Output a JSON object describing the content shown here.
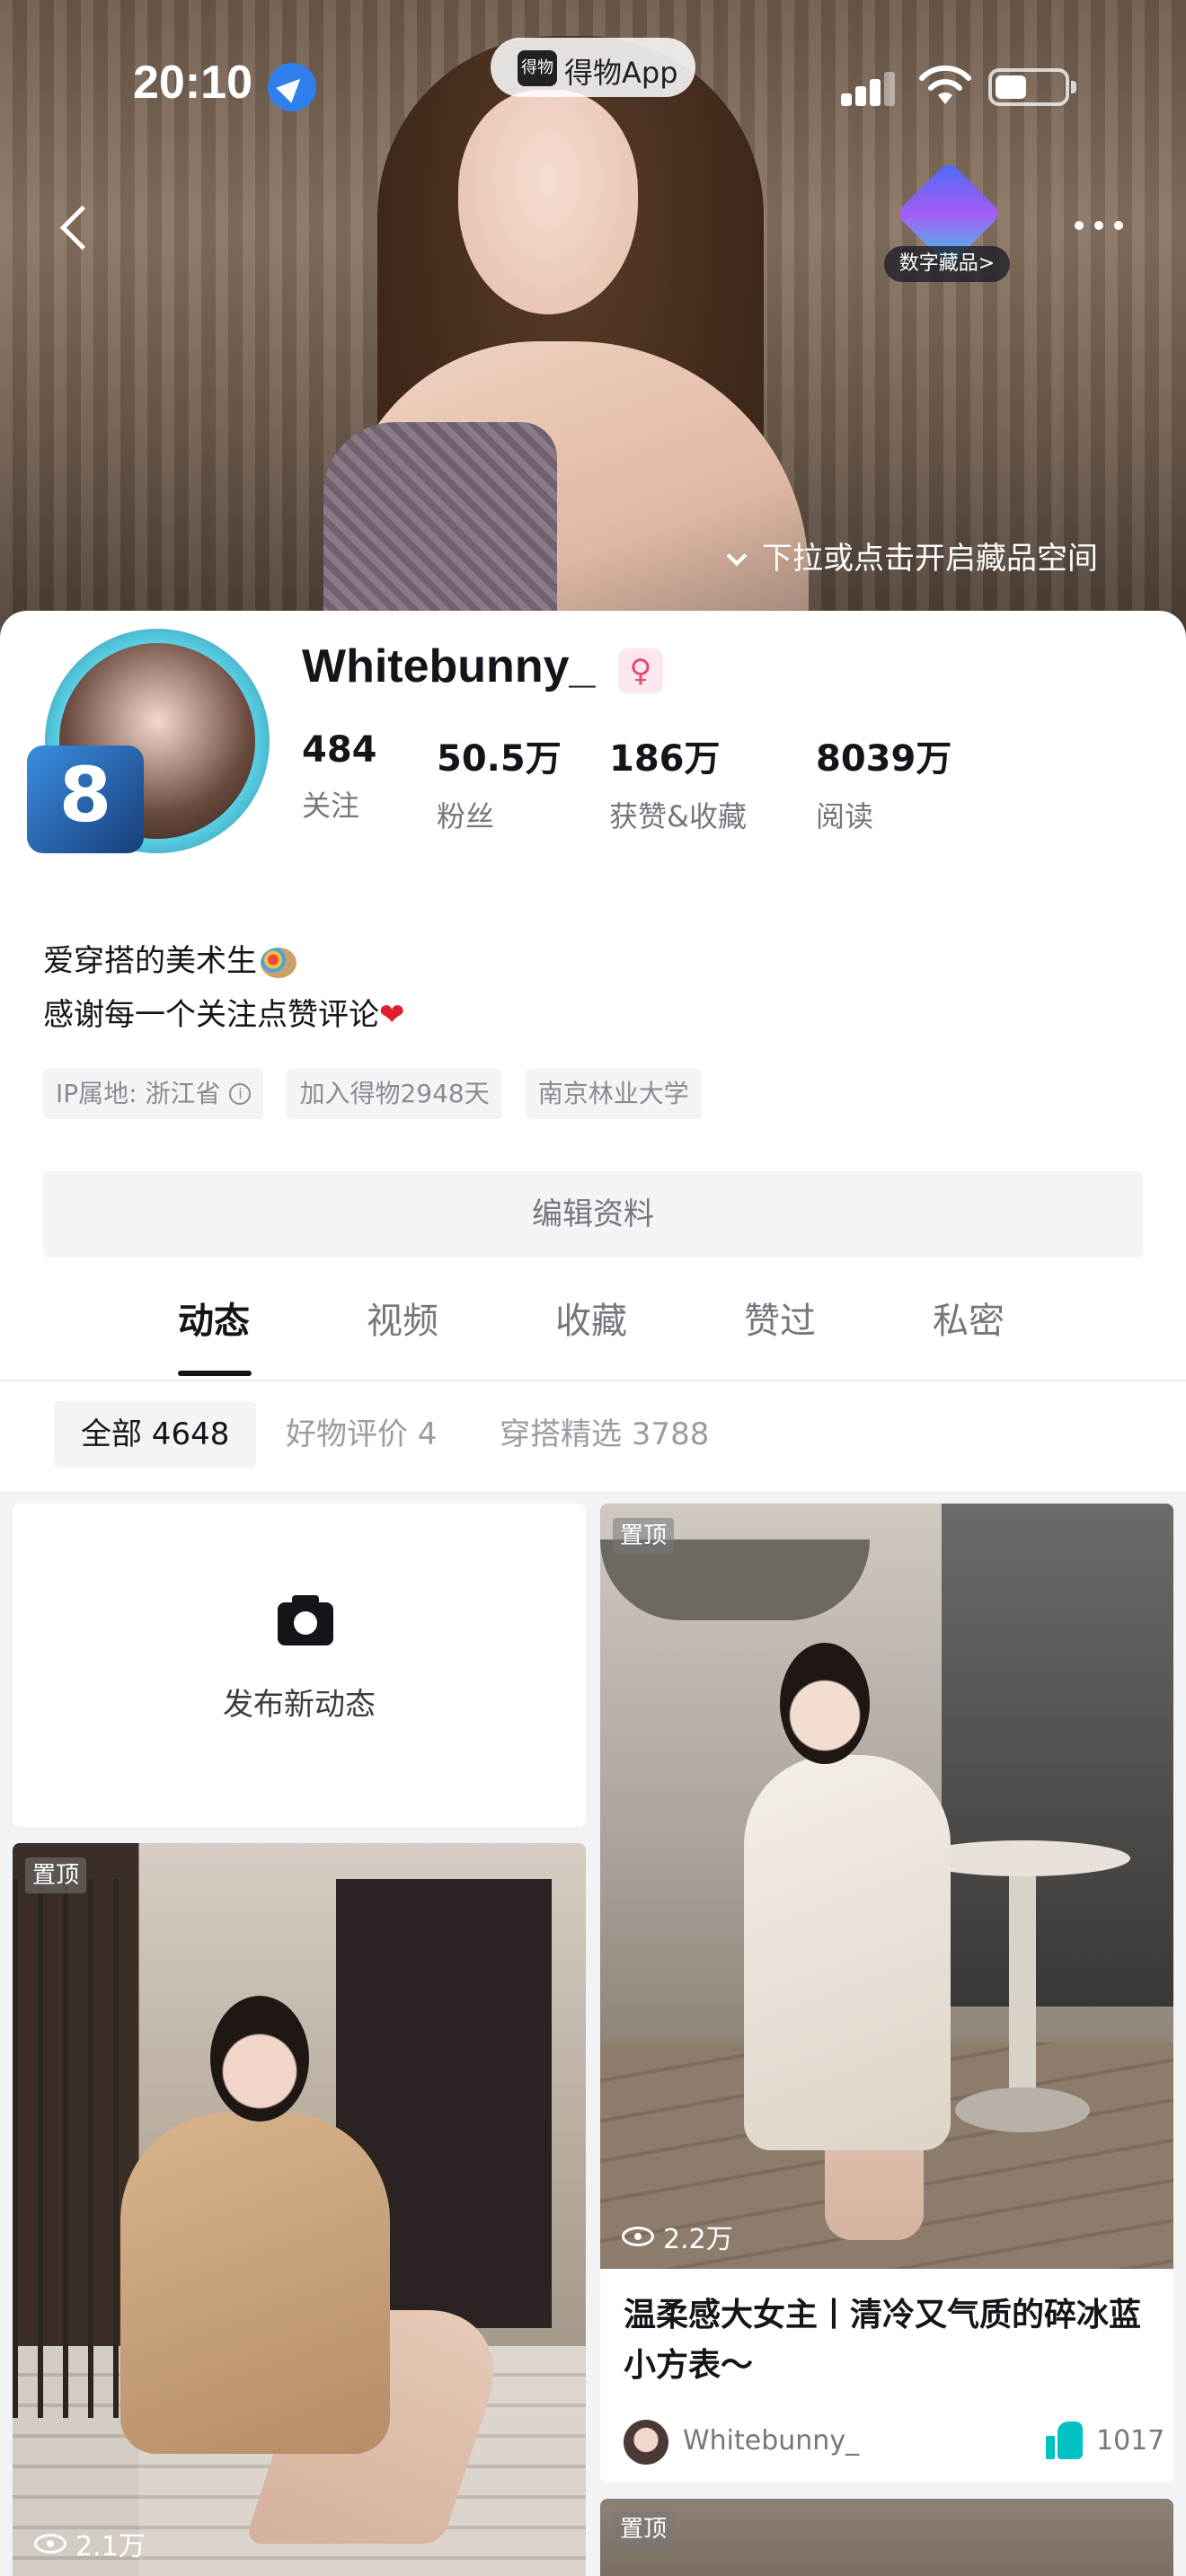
{
  "status_bar": {
    "time": "20:10",
    "app_pill": "得物App",
    "app_logo": "得物"
  },
  "header": {
    "nft_label": "数字藏品>",
    "pull_hint": "下拉或点击开启藏品空间"
  },
  "profile": {
    "username": "Whitebunny_",
    "gender_symbol": "♀",
    "avatar_badge": "8",
    "stats": [
      {
        "value": "484",
        "label": "关注"
      },
      {
        "value": "50.5万",
        "label": "粉丝"
      },
      {
        "value": "186万",
        "label": "获赞&收藏"
      },
      {
        "value": "8039万",
        "label": "阅读"
      }
    ],
    "bio_line1": "爱穿搭的美术生",
    "bio_line2": "感谢每一个关注点赞评论",
    "tags": [
      "IP属地: 浙江省",
      "加入得物2948天",
      "南京林业大学"
    ],
    "edit_button": "编辑资料"
  },
  "tabs": [
    "动态",
    "视频",
    "收藏",
    "赞过",
    "私密"
  ],
  "filters": [
    "全部 4648",
    "好物评价 4",
    "穿搭精选 3788"
  ],
  "feed": {
    "post_new_label": "发布新动态",
    "pin_label": "置顶",
    "left_card_views": "2.1万",
    "right_card": {
      "views": "2.2万",
      "title": "温柔感大女主丨清冷又气质的碎冰蓝小方表～",
      "author": "Whitebunny_",
      "likes": "1017"
    }
  },
  "colors": {
    "accent_like": "#00c2c2",
    "gender_pink": "#e8496e",
    "text_primary": "#14151a",
    "text_secondary": "#75777f"
  }
}
